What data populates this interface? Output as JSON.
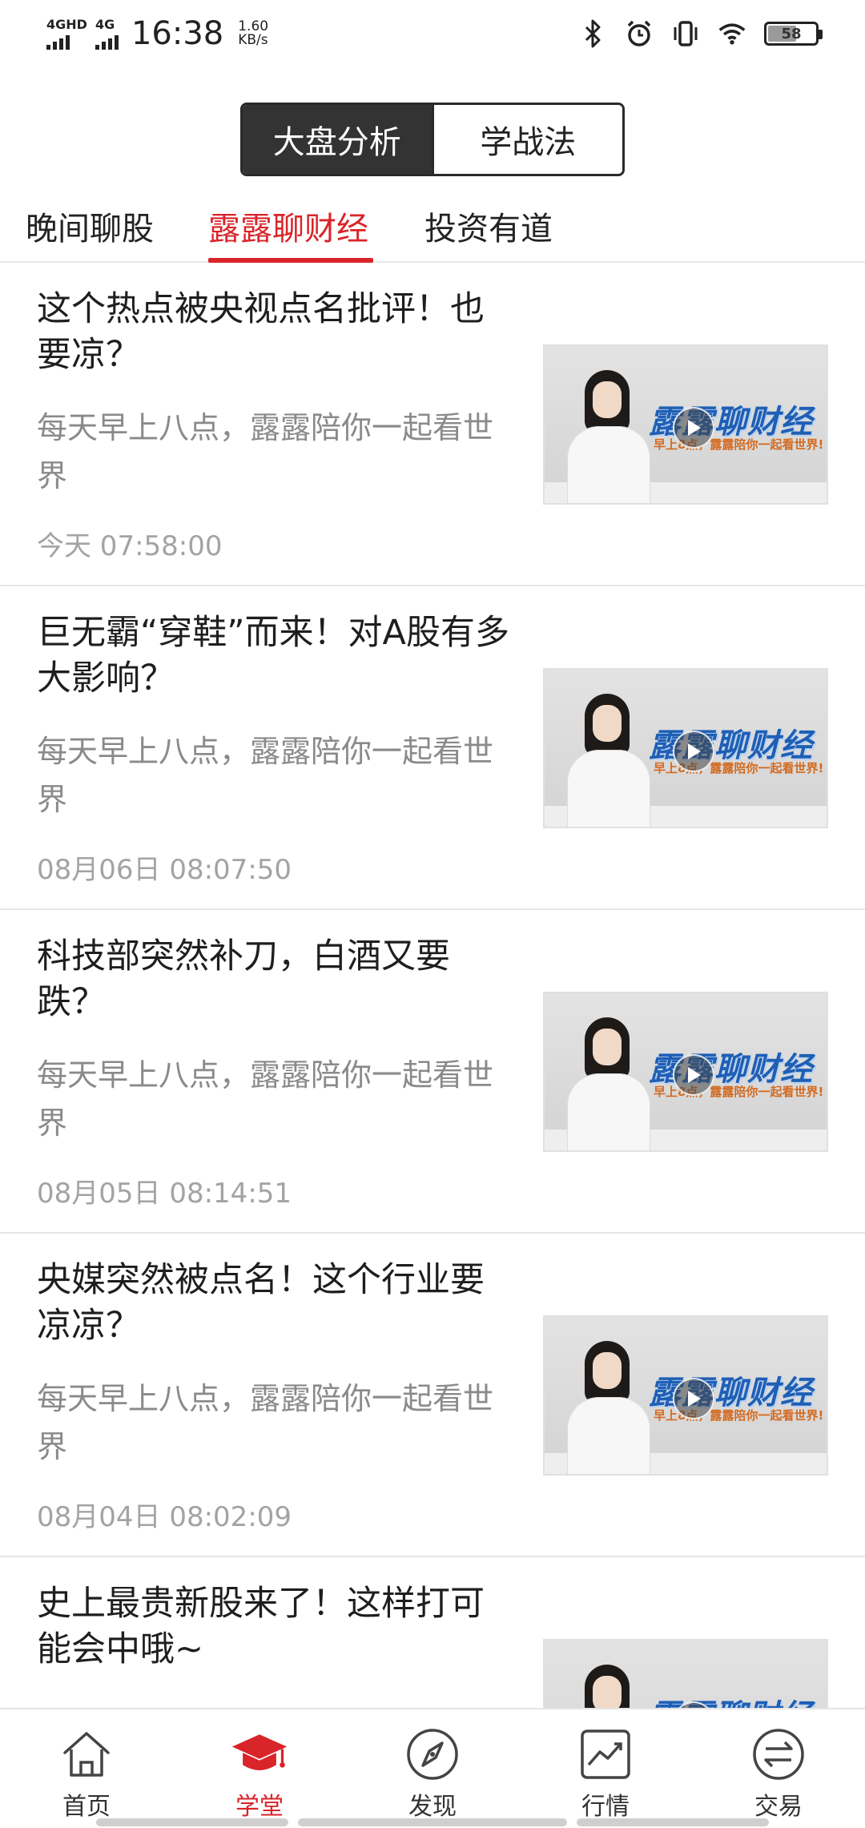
{
  "status_bar": {
    "net1": "4GHD",
    "net2": "4G",
    "time": "16:38",
    "speed_value": "1.60",
    "speed_unit": "KB/s",
    "battery": "58",
    "icons": [
      "bluetooth-icon",
      "alarm-icon",
      "vibrate-icon",
      "wifi-icon",
      "battery-icon"
    ]
  },
  "segment": {
    "items": [
      {
        "label": "大盘分析",
        "active": true
      },
      {
        "label": "学战法",
        "active": false
      }
    ]
  },
  "tabs": {
    "items": [
      {
        "label": "晚间聊股",
        "active": false
      },
      {
        "label": "露露聊财经",
        "active": true
      },
      {
        "label": "投资有道",
        "active": false
      }
    ]
  },
  "thumbnail": {
    "brand": "露露聊财经",
    "slogan": "早上8点，露露陪你一起看世界!"
  },
  "feed": [
    {
      "title": "这个热点被央视点名批评！也要凉？",
      "desc": "每天早上八点，露露陪你一起看世界",
      "time": "今天 07:58:00"
    },
    {
      "title": "巨无霸“穿鞋”而来！对A股有多大影响？",
      "desc": "每天早上八点，露露陪你一起看世界",
      "time": "08月06日 08:07:50"
    },
    {
      "title": "科技部突然补刀，白酒又要跌？",
      "desc": "每天早上八点，露露陪你一起看世界",
      "time": "08月05日 08:14:51"
    },
    {
      "title": "央媒突然被点名！这个行业要凉凉？",
      "desc": "每天早上八点，露露陪你一起看世界",
      "time": "08月04日 08:02:09"
    },
    {
      "title": "史上最贵新股来了！这样打可能会中哦~",
      "desc": "",
      "time": ""
    }
  ],
  "bottom_nav": {
    "items": [
      {
        "label": "首页",
        "icon": "home-icon",
        "active": false
      },
      {
        "label": "学堂",
        "icon": "graduation-cap-icon",
        "active": true
      },
      {
        "label": "发现",
        "icon": "compass-icon",
        "active": false
      },
      {
        "label": "行情",
        "icon": "chart-icon",
        "active": false
      },
      {
        "label": "交易",
        "icon": "exchange-icon",
        "active": false
      }
    ]
  },
  "colors": {
    "accent": "#d9242a",
    "segment_active_bg": "#333333",
    "muted_text": "#8a8a8a",
    "timestamp_text": "#a3a3a3"
  }
}
